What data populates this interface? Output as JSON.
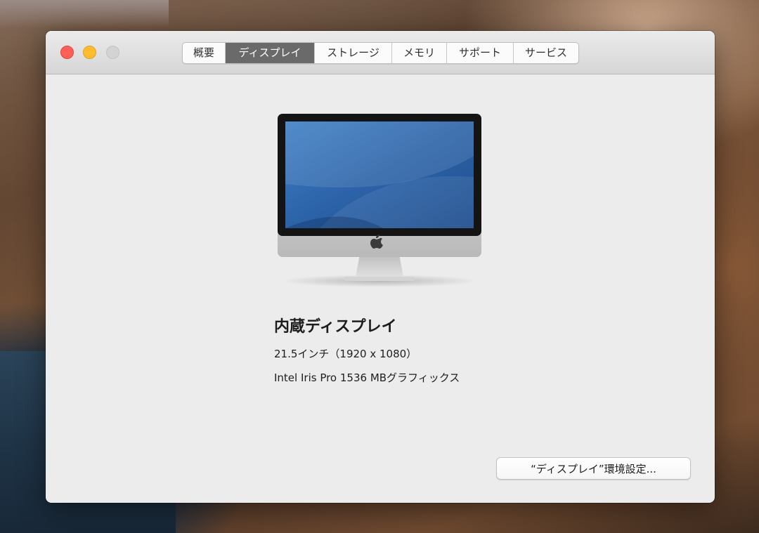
{
  "window": {
    "tabs": [
      {
        "label": "概要",
        "active": false
      },
      {
        "label": "ディスプレイ",
        "active": true
      },
      {
        "label": "ストレージ",
        "active": false
      },
      {
        "label": "メモリ",
        "active": false
      },
      {
        "label": "サポート",
        "active": false
      },
      {
        "label": "サービス",
        "active": false
      }
    ],
    "traffic_lights": {
      "close_color": "#fe5f57",
      "minimize_color": "#febc2e",
      "zoom_color": "#d3d3d3"
    }
  },
  "display": {
    "icon": "imac-icon",
    "name": "内蔵ディスプレイ",
    "size": "21.5インチ（1920 x 1080）",
    "graphics": "Intel Iris Pro 1536 MBグラフィックス"
  },
  "button": {
    "prefs_label": "“ディスプレイ”環境設定..."
  }
}
